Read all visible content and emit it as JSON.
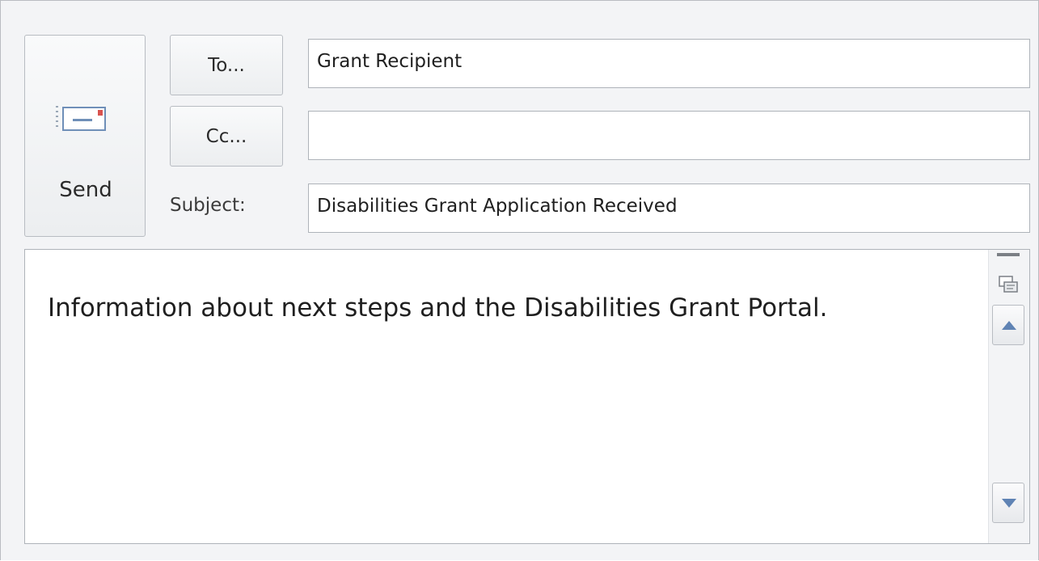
{
  "compose": {
    "send_label": "Send",
    "send_icon": "envelope-send-icon",
    "to_button_label": "To...",
    "cc_button_label": "Cc...",
    "subject_label": "Subject:",
    "to_value": "Grant Recipient",
    "cc_value": "",
    "subject_value": "Disabilities Grant Application Received",
    "body_text": "Information about next steps and the Disabilities Grant Portal."
  },
  "scrollbar": {
    "view_icon": "view-toggle-icon",
    "up_icon": "arrow-up-icon",
    "down_icon": "arrow-down-icon"
  },
  "colors": {
    "background": "#f3f4f6",
    "border": "#aeb3b9",
    "scroll_arrow": "#5f83b4",
    "send_icon_accent": "#d9534f"
  }
}
